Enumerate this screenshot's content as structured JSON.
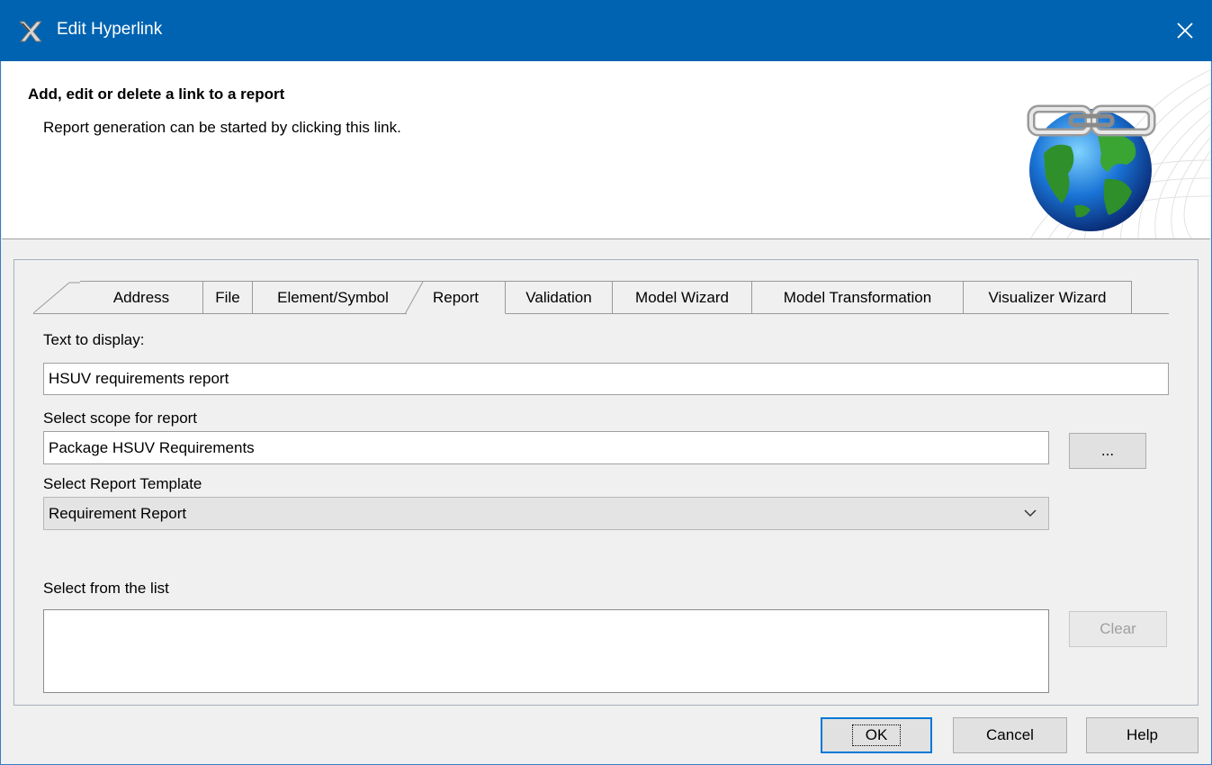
{
  "window": {
    "title": "Edit Hyperlink",
    "close_symbol": "✕",
    "accent_color": "#0063b1"
  },
  "header": {
    "heading": "Add, edit or delete a link to a report",
    "description": "Report generation can be started by clicking this link."
  },
  "tabs": [
    {
      "label": "Address",
      "active": false
    },
    {
      "label": "File",
      "active": false
    },
    {
      "label": "Element/Symbol",
      "active": false
    },
    {
      "label": "Report",
      "active": true
    },
    {
      "label": "Validation",
      "active": false
    },
    {
      "label": "Model Wizard",
      "active": false
    },
    {
      "label": "Model Transformation",
      "active": false
    },
    {
      "label": "Visualizer Wizard",
      "active": false
    }
  ],
  "form": {
    "text_to_display_label": "Text to display:",
    "text_to_display_value": "HSUV requirements report",
    "scope_label": "Select scope for report",
    "scope_value": "Package HSUV Requirements",
    "scope_browse_label": "...",
    "template_label": "Select Report Template",
    "template_value": "Requirement Report",
    "list_label": "Select from the list",
    "clear_label": "Clear"
  },
  "footer": {
    "ok_label": "OK",
    "cancel_label": "Cancel",
    "help_label": "Help"
  },
  "icons": {
    "app": "magicdraw-app-icon",
    "header": "globe-chain-link-icon",
    "dropdown": "chevron-down-icon",
    "close": "close-icon"
  }
}
